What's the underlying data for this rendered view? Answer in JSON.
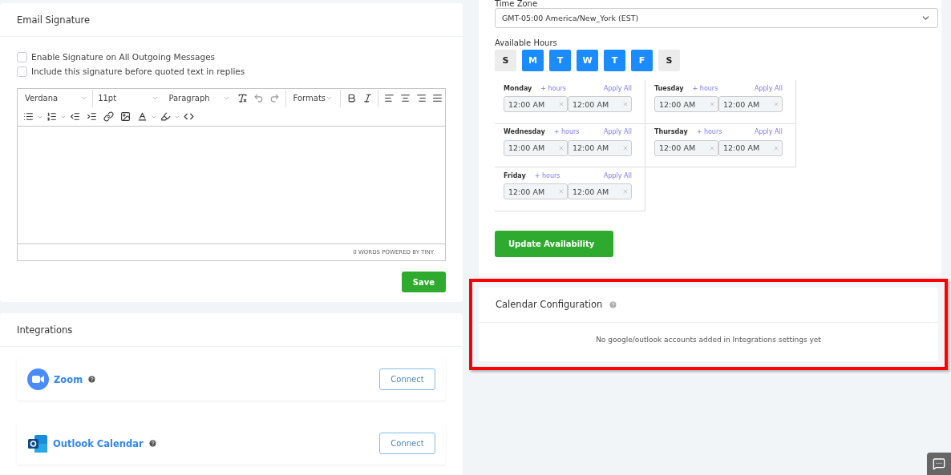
{
  "email_signature": {
    "title": "Email Signature",
    "options": [
      {
        "label": "Enable Signature on All Outgoing Messages",
        "checked": false
      },
      {
        "label": "Include this signature before quoted text in replies",
        "checked": false
      }
    ],
    "editor": {
      "font": "Verdana",
      "size": "11pt",
      "block": "Paragraph",
      "formats": "Formats",
      "status": "0 WORDS POWERED BY TINY"
    },
    "save": "Save"
  },
  "integrations": {
    "title": "Integrations",
    "items": [
      {
        "kind": "zoom",
        "name": "Zoom",
        "action": "Connect"
      },
      {
        "kind": "outlook",
        "name": "Outlook Calendar",
        "action": "Connect"
      }
    ]
  },
  "availability": {
    "time_zone_label": "Time Zone",
    "time_zone": "GMT-05:00 America/New_York (EST)",
    "hours_label": "Available Hours",
    "days": [
      {
        "letter": "S",
        "selected": false
      },
      {
        "letter": "M",
        "selected": true
      },
      {
        "letter": "T",
        "selected": true
      },
      {
        "letter": "W",
        "selected": true
      },
      {
        "letter": "T",
        "selected": true
      },
      {
        "letter": "F",
        "selected": true
      },
      {
        "letter": "S",
        "selected": false
      }
    ],
    "schedule": [
      {
        "day": "Monday",
        "add": "+ hours",
        "apply": "Apply All",
        "from": "12:00 AM",
        "to": "12:00 AM"
      },
      {
        "day": "Tuesday",
        "add": "+ hours",
        "apply": "Apply All",
        "from": "12:00 AM",
        "to": "12:00 AM"
      },
      {
        "day": "Wednesday",
        "add": "+ hours",
        "apply": "Apply All",
        "from": "12:00 AM",
        "to": "12:00 AM"
      },
      {
        "day": "Thursday",
        "add": "+ hours",
        "apply": "Apply All",
        "from": "12:00 AM",
        "to": "12:00 AM"
      },
      {
        "day": "Friday",
        "add": "+ hours",
        "apply": "Apply All",
        "from": "12:00 AM",
        "to": "12:00 AM"
      }
    ],
    "button": "Update Availability"
  },
  "calendar_configuration": {
    "title": "Calendar Configuration",
    "message": "No google/outlook accounts added in Integrations settings yet",
    "highlighted": true
  }
}
